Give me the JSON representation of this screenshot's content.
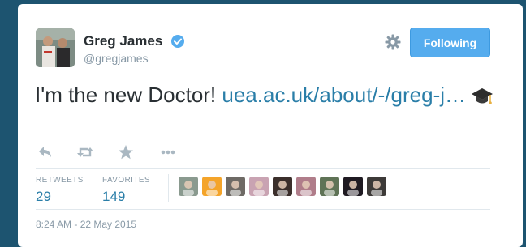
{
  "tweet": {
    "author": {
      "name": "Greg James",
      "handle": "@gregjames",
      "verified": true
    },
    "follow_button_label": "Following",
    "text": "I'm the new Doctor! ",
    "link_text": "uea.ac.uk/about/-/greg-j…",
    "emoji_icon": "graduation-cap-icon",
    "stats": {
      "retweets_label": "RETWEETS",
      "retweets_value": "29",
      "favorites_label": "FAVORITES",
      "favorites_value": "149"
    },
    "timestamp": "8:24 AM - 22 May 2015"
  },
  "colors": {
    "background": "#1d5470",
    "accent": "#55acee",
    "link": "#2a7ea8",
    "muted": "#8899a6",
    "text": "#292f33"
  },
  "actions": [
    "reply-icon",
    "retweet-icon",
    "favorite-icon",
    "more-icon"
  ],
  "favoriters": [
    {
      "icon": "user-avatar-1",
      "color": "#8a9a8f"
    },
    {
      "icon": "user-avatar-2",
      "color": "#f4a42a"
    },
    {
      "icon": "user-avatar-3",
      "color": "#6e6a65"
    },
    {
      "icon": "user-avatar-4",
      "color": "#c9a3b2"
    },
    {
      "icon": "user-avatar-5",
      "color": "#3b2f2b"
    },
    {
      "icon": "user-avatar-6",
      "color": "#b07d8a"
    },
    {
      "icon": "user-avatar-7",
      "color": "#5f7356"
    },
    {
      "icon": "user-avatar-8",
      "color": "#1f1a22"
    },
    {
      "icon": "user-avatar-9",
      "color": "#3d3a38"
    }
  ]
}
